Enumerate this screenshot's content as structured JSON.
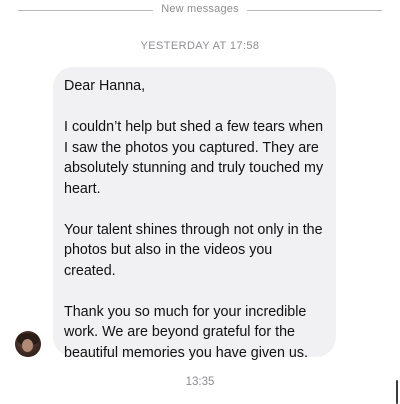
{
  "divider": {
    "label": "New messages"
  },
  "conversation": {
    "timestamp_top": "YESTERDAY AT 17:58",
    "timestamp_bottom": "13:35"
  },
  "message": {
    "sender_avatar_icon": "avatar-photo",
    "paragraphs": [
      "Dear Hanna,",
      "I couldn’t help but shed a few tears when I saw the photos you captured. They are absolutely stunning and truly touched my heart.",
      "Your talent shines through not only in the photos but also in the videos you created.",
      "Thank you so much for your incredible work. We are beyond grateful for the beautiful memories you have given us."
    ],
    "bubble_color": "#f1f1f4"
  },
  "colors": {
    "meta_text": "#8e8e93",
    "divider_line": "#b9b9bd",
    "message_text": "#111111"
  }
}
